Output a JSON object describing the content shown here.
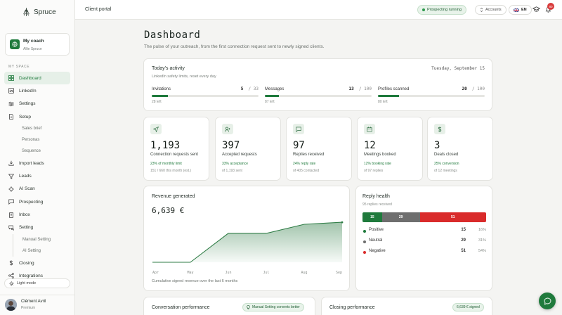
{
  "brand": {
    "name": "Spruce"
  },
  "coach": {
    "title": "My coach",
    "name": "Allie Spruce"
  },
  "sidebar": {
    "section_label": "MY SPACE",
    "items": [
      {
        "label": "Dashboard",
        "icon": "grid-icon",
        "active": true
      },
      {
        "label": "LinkedIn",
        "icon": "linkedin-icon"
      },
      {
        "label": "Settings",
        "icon": "sliders-icon"
      },
      {
        "label": "Setup",
        "icon": "document-icon"
      },
      {
        "label": "Sales brief"
      },
      {
        "label": "Personas"
      },
      {
        "label": "Sequence"
      },
      {
        "label": "Import leads",
        "icon": "download-icon"
      },
      {
        "label": "Leads",
        "icon": "filter-icon"
      },
      {
        "label": "AI Scan",
        "icon": "scan-icon"
      },
      {
        "label": "Prospecting",
        "icon": "message-icon"
      },
      {
        "label": "Inbox",
        "icon": "inbox-icon"
      },
      {
        "label": "Setting",
        "icon": "setting-icon"
      },
      {
        "label": "Manual Setting"
      },
      {
        "label": "AI Setting"
      },
      {
        "label": "Closing",
        "icon": "dollar-icon"
      },
      {
        "label": "Integrations",
        "icon": "share-icon"
      }
    ],
    "light_mode": "Light mode"
  },
  "user": {
    "name": "Clément Avril",
    "plan": "Premium"
  },
  "topbar": {
    "crumb": "Client portal",
    "status": "Prospecting running",
    "accounts": "Accounts",
    "lang": "EN",
    "notifications": "80"
  },
  "page": {
    "title": "Dashboard",
    "subtitle": "The pulse of your outreach, from the first connection request sent to newly signed clients."
  },
  "activity": {
    "title": "Today's activity",
    "subtitle": "LinkedIn safety limits, reset every day",
    "date": "Tuesday, September 15",
    "meters": [
      {
        "label": "Invitations",
        "value": "5",
        "max": "/ 33",
        "fraction": 0.15,
        "left": "28 left"
      },
      {
        "label": "Messages",
        "value": "13",
        "max": "/ 100",
        "fraction": 0.13,
        "left": "87 left"
      },
      {
        "label": "Profiles scanned",
        "value": "20",
        "max": "/ 100",
        "fraction": 0.2,
        "left": "80 left"
      }
    ]
  },
  "kpis": [
    {
      "icon": "send-icon",
      "value": "1,193",
      "label": "Connection requests sent",
      "green": "23% of monthly limit",
      "foot": "151 / 660 this month (est.)"
    },
    {
      "icon": "user-plus-icon",
      "value": "397",
      "label": "Accepted requests",
      "green": "33% acceptance",
      "foot": "of 1,193 sent"
    },
    {
      "icon": "chat-icon",
      "value": "97",
      "label": "Replies received",
      "green": "24% reply rate",
      "foot": "of 405 contacted"
    },
    {
      "icon": "calendar-icon",
      "value": "12",
      "label": "Meetings booked",
      "green": "12% booking rate",
      "foot": "of 97 replies"
    },
    {
      "icon": "dollar-icon",
      "value": "3",
      "label": "Deals closed",
      "green": "25% conversion",
      "foot": "of 12 meetings"
    }
  ],
  "revenue": {
    "title": "Revenue generated",
    "amount": "6,639 €",
    "caption": "Cumulative signed revenue over the last 6 months"
  },
  "chart_data": {
    "type": "area",
    "categories": [
      "Apr",
      "May",
      "Jun",
      "Jul",
      "Aug",
      "Sep"
    ],
    "values": [
      0,
      0,
      4800,
      4800,
      6300,
      6639
    ],
    "title": "Revenue generated",
    "ylim": [
      0,
      7000
    ],
    "grid": false,
    "color": "#2f7d46"
  },
  "reply_health": {
    "title": "Reply health",
    "subtitle": "95 replies received",
    "segments": [
      {
        "label": "Positive",
        "count": "15",
        "pct": "16%",
        "value": 15,
        "color": "#1f7a3c"
      },
      {
        "label": "Neutral",
        "count": "29",
        "pct": "31%",
        "value": 29,
        "color": "#6e6e6e"
      },
      {
        "label": "Negative",
        "count": "51",
        "pct": "54%",
        "value": 51,
        "color": "#d92b2b"
      }
    ]
  },
  "conversation": {
    "title": "Conversation performance",
    "pill": "Manual Setting converts better"
  },
  "closing": {
    "title": "Closing performance",
    "pill": "6,639 € signed"
  }
}
